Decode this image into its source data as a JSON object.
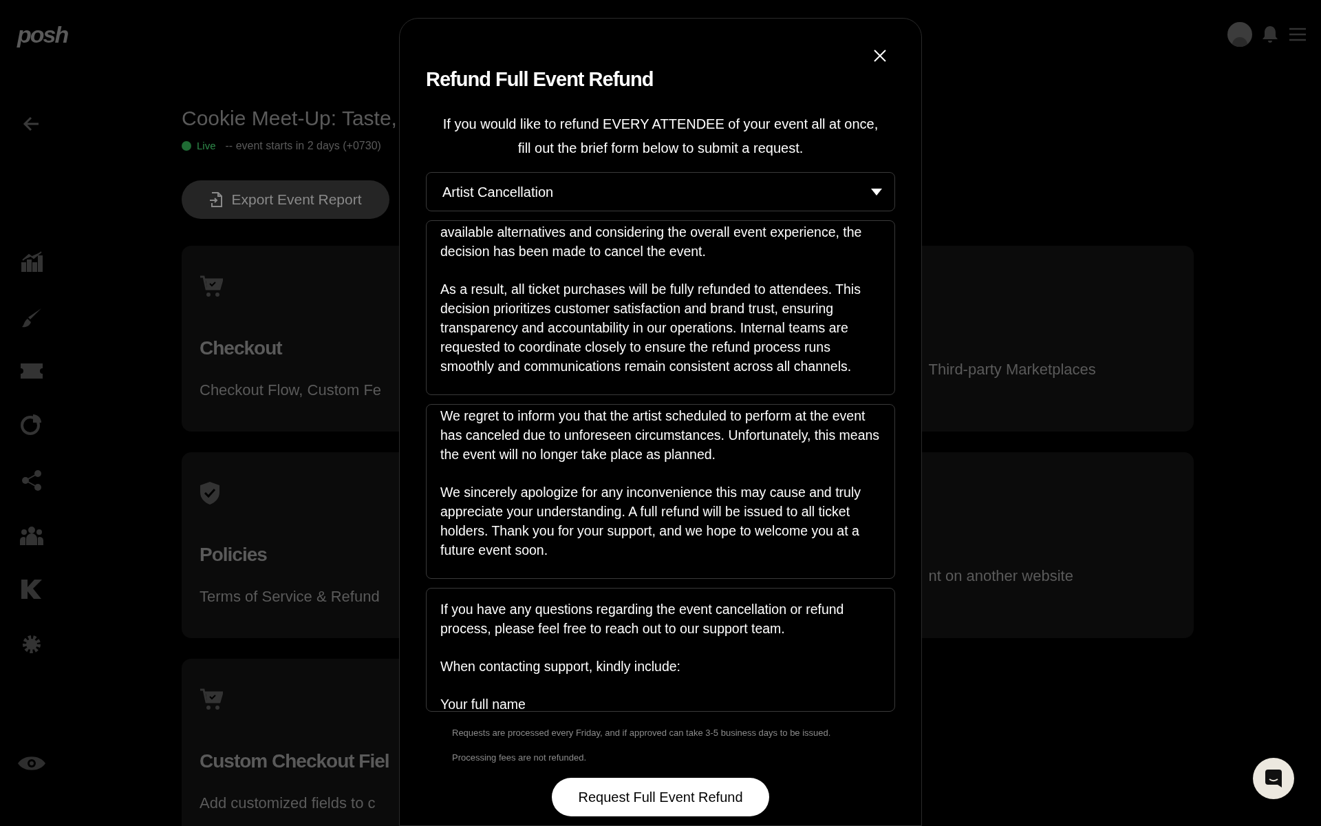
{
  "header": {
    "logo": "posh"
  },
  "event": {
    "title": "Cookie Meet-Up: Taste,",
    "status": {
      "label": "Live",
      "color": "#1f6b34"
    },
    "starts": "-- event starts in 2 days (+0730)"
  },
  "export_button": "Export Event Report",
  "cards": [
    {
      "kind": "cart",
      "title": "Checkout",
      "description": "Checkout Flow, Custom Fe",
      "right_description": "Third-party Marketplaces"
    },
    {
      "kind": "shield",
      "title": "Policies",
      "description": "Terms of Service & Refund",
      "right_description": "nt on another website"
    },
    {
      "kind": "cart",
      "title": "Custom Checkout Fiel",
      "description": "Add customized fields to c"
    }
  ],
  "modal": {
    "title": "Refund Full Event Refund",
    "intro": "If you would like to refund EVERY ATTENDEE of your event all at once, fill out the brief form below to submit a request.",
    "reason": {
      "value": "Artist Cancellation"
    },
    "text_boxes": [
      [
        "available alternatives and considering the overall event experience, the decision has been made to cancel the event.",
        "As a result, all ticket purchases will be fully refunded to attendees. This decision prioritizes customer satisfaction and brand trust, ensuring transparency and accountability in our operations. Internal teams are requested to coordinate closely to ensure the refund process runs smoothly and communications remain consistent across all channels."
      ],
      [
        "We regret to inform you that the artist scheduled to perform at the event has canceled due to unforeseen circumstances. Unfortunately, this means the event will no longer take place as planned.",
        "We sincerely apologize for any inconvenience this may cause and truly appreciate your understanding. A full refund will be issued to all ticket holders. Thank you for your support, and we hope to welcome you at a future event soon."
      ],
      [
        "If you have any questions regarding the event cancellation or refund process, please feel free to reach out to our support team.",
        "When contacting support, kindly include:",
        "Your full name"
      ]
    ],
    "note": "Requests are processed every Friday, and if approved can take 3-5 business days to be issued. Processing fees are not refunded.",
    "submit_button": "Request Full Event Refund"
  }
}
